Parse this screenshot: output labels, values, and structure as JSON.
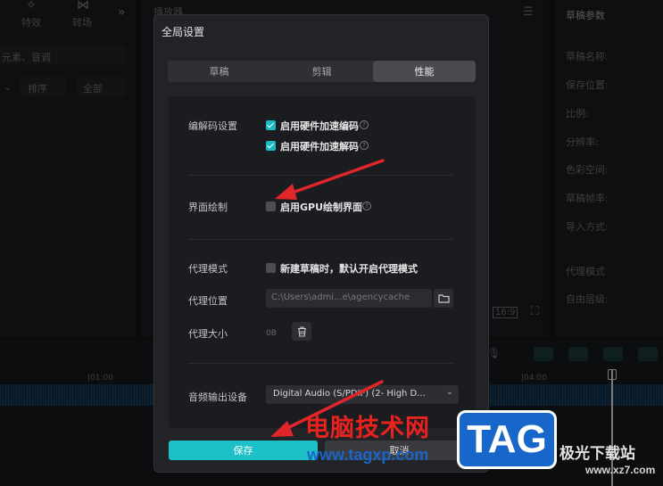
{
  "background": {
    "top_tools": [
      "特效",
      "转场"
    ],
    "search_placeholder": "元素、音调",
    "sort_label": "排序",
    "all_label": "全部",
    "player_title": "播放器",
    "aspect_badge": "16:9",
    "draft_params_title": "草稿参数",
    "draft_params": [
      "草稿名称:",
      "保存位置:",
      "比例:",
      "分辨率:",
      "色彩空间:",
      "草稿帧率:",
      "导入方式:",
      "代理模式",
      "自由层级:"
    ],
    "timeline_marks": [
      "|01:00",
      "|04:00"
    ]
  },
  "dialog": {
    "title": "全局设置",
    "tabs": [
      {
        "label": "草稿",
        "active": false
      },
      {
        "label": "剪辑",
        "active": false
      },
      {
        "label": "性能",
        "active": true
      }
    ],
    "decode_label": "编解码设置",
    "hw_encode": "启用硬件加速编码",
    "hw_decode": "启用硬件加速解码",
    "ui_render_label": "界面绘制",
    "gpu_render": "启用GPU绘制界面",
    "proxy_mode_label": "代理模式",
    "proxy_mode_option": "新建草稿时，默认开启代理模式",
    "proxy_location_label": "代理位置",
    "proxy_location_value": "C:\\Users\\admi...e\\agencycache",
    "proxy_size_label": "代理大小",
    "proxy_size_value": "0B",
    "audio_output_label": "音频输出设备",
    "audio_output_value": "Digital Audio (S/PDIF) (2- High D...",
    "save": "保存",
    "cancel": "取消"
  },
  "watermark": {
    "site_cn": "电脑技术网",
    "site_url": "www.tagxp.com",
    "tag": "TAG",
    "right_cn": "极光下载站",
    "right_url": "www.xz7.com"
  },
  "colors": {
    "accent": "#1ec0c8",
    "arrow": "#e0262a",
    "watermark_red": "#e8231f",
    "watermark_blue": "#1a64c8"
  }
}
